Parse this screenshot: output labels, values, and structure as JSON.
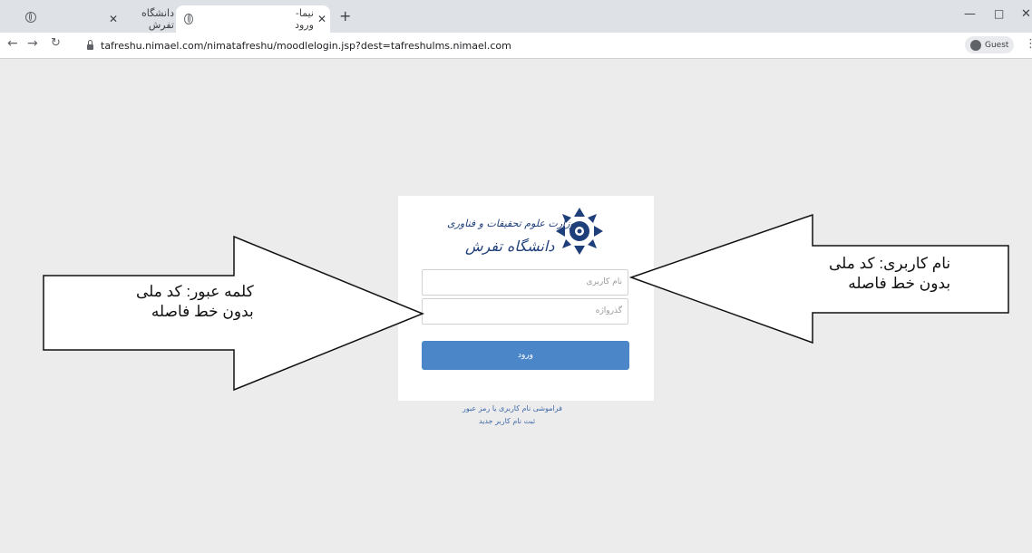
{
  "browser": {
    "tabs": [
      {
        "title": "دانشگاه تفرش",
        "active": false
      },
      {
        "title": "نیما-ورود",
        "active": true
      }
    ],
    "new_tab": "+",
    "url": "tafreshu.nimael.com/nimatafreshu/moodlelogin.jsp?dest=tafreshulms.nimael.com",
    "profile": "Guest"
  },
  "login": {
    "logo_line1": "وزارت علوم تحقیقات و فناوری",
    "logo_line2": "دانشگاه تفرش",
    "username_placeholder": "نام کاربری",
    "password_placeholder": "گذرواژه",
    "submit_label": "ورود",
    "forgot_link": "فراموشی نام کاربری یا رمز عبور",
    "register_link": "ثبت نام کاربر جدید",
    "colors": {
      "button": "#4a86c8",
      "logo": "#1f3f7a",
      "link": "#3b67a8"
    }
  },
  "annotations": {
    "left": {
      "line1": "کلمه عبور: کد ملی",
      "line2": "بدون خط فاصله"
    },
    "right": {
      "line1": "نام کاربری: کد ملی",
      "line2": "بدون خط فاصله"
    }
  }
}
